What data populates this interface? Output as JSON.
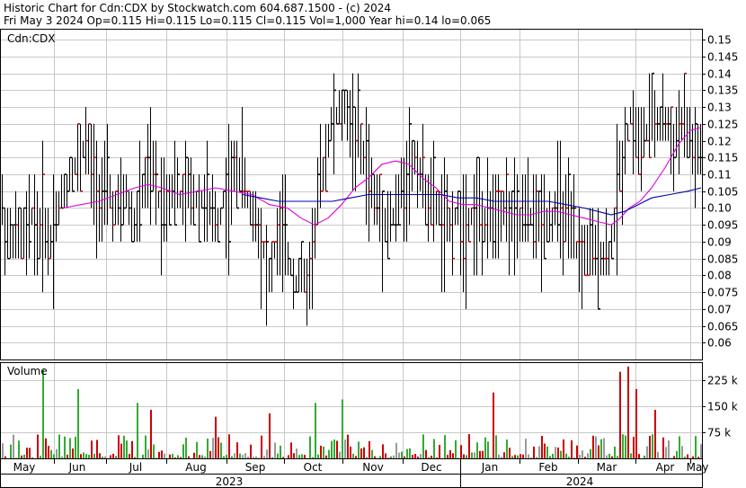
{
  "header": {
    "line1": "Historic Chart for Cdn:CDX by Stockwatch.com 604.687.1500 - (c) 2024",
    "line2": "Fri May  3 2024  Op=0.115  Hi=0.115  Lo=0.115  Cl=0.115  Vol=1,000  Year hi=0.14  lo=0.065"
  },
  "price_panel": {
    "symbol_label": "Cdn:CDX"
  },
  "volume_panel": {
    "label": "Volume"
  },
  "colors": {
    "bar_default": "#000000",
    "bar_close_up": "#dd0000",
    "ma_short": "#dd00dd",
    "ma_long": "#0000aa",
    "vol_up": "#33aa33",
    "vol_down": "#cc0000",
    "vol_flat": "#999999",
    "grid": "#c8c8c8"
  },
  "chart_data": [
    {
      "type": "ohlc",
      "series_name": "Cdn:CDX",
      "y_ticks": [
        0.06,
        0.065,
        0.07,
        0.075,
        0.08,
        0.085,
        0.09,
        0.095,
        0.1,
        0.105,
        0.11,
        0.115,
        0.12,
        0.125,
        0.13,
        0.135,
        0.14,
        0.145,
        0.15
      ],
      "y_tick_labels": [
        "0.06",
        "0.065",
        "0.07",
        "0.075",
        "0.08",
        "0.085",
        "0.09",
        "0.095",
        "0.10",
        "0.105",
        "0.11",
        "0.115",
        "0.12",
        "0.125",
        "0.13",
        "0.135",
        "0.14",
        "0.145",
        "0.15"
      ],
      "ylim": [
        0.055,
        0.153
      ],
      "x_labels": [
        "May",
        "Jun",
        "Jul",
        "Aug",
        "Sep",
        "Oct",
        "Nov",
        "Dec",
        "Jan",
        "Feb",
        "Mar",
        "Apr",
        "May"
      ],
      "year_labels": [
        "2023",
        "2024"
      ],
      "grid": true,
      "price_path": [
        [
          0,
          0.1
        ],
        [
          6,
          0.095
        ],
        [
          12,
          0.09
        ],
        [
          18,
          0.094
        ],
        [
          24,
          0.092
        ],
        [
          30,
          0.09
        ],
        [
          36,
          0.098
        ],
        [
          42,
          0.093
        ],
        [
          48,
          0.096
        ],
        [
          54,
          0.088
        ],
        [
          60,
          0.095
        ],
        [
          66,
          0.1
        ],
        [
          72,
          0.105
        ],
        [
          78,
          0.11
        ],
        [
          84,
          0.113
        ],
        [
          90,
          0.116
        ],
        [
          96,
          0.118
        ],
        [
          102,
          0.112
        ],
        [
          108,
          0.105
        ],
        [
          114,
          0.102
        ],
        [
          120,
          0.104
        ],
        [
          126,
          0.1
        ],
        [
          132,
          0.098
        ],
        [
          138,
          0.104
        ],
        [
          144,
          0.1
        ],
        [
          150,
          0.096
        ],
        [
          156,
          0.103
        ],
        [
          162,
          0.108
        ],
        [
          168,
          0.112
        ],
        [
          174,
          0.106
        ],
        [
          180,
          0.1
        ],
        [
          186,
          0.102
        ],
        [
          192,
          0.108
        ],
        [
          198,
          0.105
        ],
        [
          204,
          0.102
        ],
        [
          210,
          0.106
        ],
        [
          216,
          0.104
        ],
        [
          222,
          0.1
        ],
        [
          228,
          0.104
        ],
        [
          234,
          0.098
        ],
        [
          240,
          0.095
        ],
        [
          246,
          0.1
        ],
        [
          252,
          0.104
        ],
        [
          258,
          0.108
        ],
        [
          264,
          0.112
        ],
        [
          270,
          0.109
        ],
        [
          276,
          0.103
        ],
        [
          282,
          0.098
        ],
        [
          288,
          0.092
        ],
        [
          294,
          0.085
        ],
        [
          300,
          0.08
        ],
        [
          306,
          0.088
        ],
        [
          312,
          0.092
        ],
        [
          318,
          0.087
        ],
        [
          324,
          0.083
        ],
        [
          330,
          0.078
        ],
        [
          336,
          0.08
        ],
        [
          342,
          0.076
        ],
        [
          348,
          0.09
        ],
        [
          354,
          0.104
        ],
        [
          360,
          0.114
        ],
        [
          366,
          0.122
        ],
        [
          372,
          0.128
        ],
        [
          378,
          0.126
        ],
        [
          384,
          0.13
        ],
        [
          390,
          0.124
        ],
        [
          396,
          0.122
        ],
        [
          402,
          0.118
        ],
        [
          408,
          0.112
        ],
        [
          414,
          0.105
        ],
        [
          420,
          0.1
        ],
        [
          426,
          0.097
        ],
        [
          432,
          0.095
        ],
        [
          438,
          0.098
        ],
        [
          444,
          0.102
        ],
        [
          450,
          0.108
        ],
        [
          456,
          0.112
        ],
        [
          462,
          0.115
        ],
        [
          468,
          0.11
        ],
        [
          474,
          0.105
        ],
        [
          480,
          0.102
        ],
        [
          486,
          0.098
        ],
        [
          492,
          0.095
        ],
        [
          498,
          0.094
        ],
        [
          504,
          0.096
        ],
        [
          510,
          0.098
        ],
        [
          516,
          0.095
        ],
        [
          522,
          0.097
        ],
        [
          528,
          0.099
        ],
        [
          534,
          0.096
        ],
        [
          540,
          0.094
        ],
        [
          546,
          0.097
        ],
        [
          552,
          0.1
        ],
        [
          558,
          0.103
        ],
        [
          564,
          0.099
        ],
        [
          570,
          0.096
        ],
        [
          576,
          0.094
        ],
        [
          582,
          0.097
        ],
        [
          588,
          0.099
        ],
        [
          594,
          0.097
        ],
        [
          600,
          0.095
        ],
        [
          606,
          0.099
        ],
        [
          612,
          0.097
        ],
        [
          618,
          0.1
        ],
        [
          624,
          0.102
        ],
        [
          630,
          0.096
        ],
        [
          636,
          0.092
        ],
        [
          642,
          0.088
        ],
        [
          648,
          0.085
        ],
        [
          654,
          0.09
        ],
        [
          660,
          0.086
        ],
        [
          666,
          0.085
        ],
        [
          672,
          0.088
        ],
        [
          678,
          0.086
        ],
        [
          684,
          0.098
        ],
        [
          690,
          0.112
        ],
        [
          696,
          0.122
        ],
        [
          702,
          0.128
        ],
        [
          708,
          0.12
        ],
        [
          714,
          0.118
        ],
        [
          720,
          0.124
        ],
        [
          726,
          0.128
        ],
        [
          732,
          0.125
        ],
        [
          738,
          0.13
        ],
        [
          744,
          0.122
        ],
        [
          750,
          0.118
        ],
        [
          756,
          0.126
        ],
        [
          762,
          0.123
        ],
        [
          768,
          0.118
        ],
        [
          774,
          0.116
        ],
        [
          780,
          0.115
        ]
      ],
      "ma_short_path": [
        [
          70,
          0.1
        ],
        [
          90,
          0.101
        ],
        [
          110,
          0.102
        ],
        [
          130,
          0.104
        ],
        [
          150,
          0.106
        ],
        [
          165,
          0.107
        ],
        [
          180,
          0.106
        ],
        [
          200,
          0.104
        ],
        [
          220,
          0.105
        ],
        [
          240,
          0.106
        ],
        [
          260,
          0.105
        ],
        [
          280,
          0.104
        ],
        [
          300,
          0.101
        ],
        [
          320,
          0.1
        ],
        [
          335,
          0.097
        ],
        [
          350,
          0.095
        ],
        [
          365,
          0.097
        ],
        [
          380,
          0.101
        ],
        [
          395,
          0.106
        ],
        [
          410,
          0.109
        ],
        [
          425,
          0.113
        ],
        [
          440,
          0.114
        ],
        [
          455,
          0.113
        ],
        [
          470,
          0.109
        ],
        [
          485,
          0.106
        ],
        [
          500,
          0.102
        ],
        [
          515,
          0.101
        ],
        [
          530,
          0.101
        ],
        [
          545,
          0.1
        ],
        [
          560,
          0.099
        ],
        [
          575,
          0.098
        ],
        [
          590,
          0.098
        ],
        [
          605,
          0.099
        ],
        [
          620,
          0.099
        ],
        [
          635,
          0.098
        ],
        [
          650,
          0.097
        ],
        [
          665,
          0.096
        ],
        [
          680,
          0.095
        ],
        [
          690,
          0.097
        ],
        [
          700,
          0.1
        ],
        [
          712,
          0.102
        ],
        [
          725,
          0.106
        ],
        [
          740,
          0.112
        ],
        [
          755,
          0.119
        ],
        [
          768,
          0.123
        ],
        [
          780,
          0.124
        ]
      ],
      "ma_long_path": [
        [
          270,
          0.104
        ],
        [
          290,
          0.103
        ],
        [
          310,
          0.102
        ],
        [
          330,
          0.102
        ],
        [
          350,
          0.102
        ],
        [
          370,
          0.102
        ],
        [
          390,
          0.103
        ],
        [
          410,
          0.104
        ],
        [
          430,
          0.104
        ],
        [
          450,
          0.104
        ],
        [
          470,
          0.104
        ],
        [
          490,
          0.104
        ],
        [
          510,
          0.103
        ],
        [
          530,
          0.103
        ],
        [
          550,
          0.102
        ],
        [
          570,
          0.102
        ],
        [
          590,
          0.102
        ],
        [
          610,
          0.102
        ],
        [
          630,
          0.101
        ],
        [
          650,
          0.1
        ],
        [
          665,
          0.099
        ],
        [
          680,
          0.098
        ],
        [
          695,
          0.099
        ],
        [
          710,
          0.101
        ],
        [
          725,
          0.103
        ],
        [
          745,
          0.104
        ],
        [
          765,
          0.105
        ],
        [
          780,
          0.106
        ]
      ],
      "year_hi": 0.14,
      "year_lo": 0.065
    },
    {
      "type": "bar",
      "series_name": "Volume",
      "y_ticks": [
        75000,
        150000,
        225000
      ],
      "y_tick_labels": [
        "75 k",
        "150 k",
        "225 k"
      ],
      "ylim": [
        0,
        275000
      ]
    }
  ]
}
